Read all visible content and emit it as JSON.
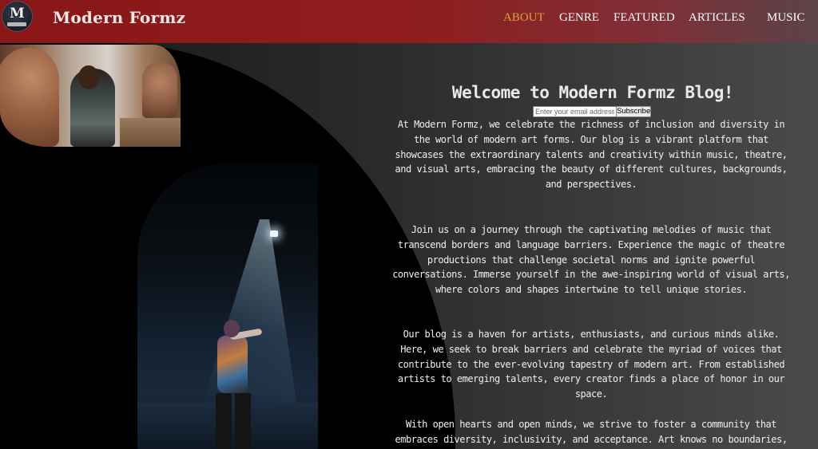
{
  "header": {
    "logo_letter": "M",
    "brand": "Modern Formz",
    "accent_color": "#d8a33a",
    "header_color": "#8a1717"
  },
  "nav": {
    "items": [
      {
        "label": "ABOUT",
        "active": true
      },
      {
        "label": "GENRE",
        "active": false
      },
      {
        "label": "FEATURED",
        "active": false
      },
      {
        "label": "ARTICLES",
        "active": false
      },
      {
        "label": "MUSIC",
        "active": false
      }
    ]
  },
  "main": {
    "title": "Welcome to Modern Formz Blog!",
    "subscribe": {
      "placeholder": "Enter your email address",
      "button_label": "Subscribe"
    },
    "paragraphs": [
      "At Modern Formz, we celebrate the richness of inclusion and diversity in the world of modern art forms. Our blog is a vibrant platform that showcases the extraordinary talents and creativity within music, theatre, and visual arts, embracing the beauty of different cultures, backgrounds, and perspectives.",
      "Join us on a journey through the captivating melodies of music that transcend borders and language barriers. Experience the magic of theatre productions that challenge societal norms and ignite powerful conversations. Immerse yourself in the awe-inspiring world of visual arts, where colors and shapes intertwine to tell unique stories.",
      "Our blog is a haven for artists, enthusiasts, and curious minds alike. Here, we seek to break barriers and celebrate the myriad of voices that contribute to the ever-evolving tapestry of modern art. From established artists to emerging talents, every creator finds a place of honor in our space.",
      "With open hearts and open minds, we strive to foster a community that embraces diversity, inclusivity, and acceptance. Art knows no boundaries,"
    ]
  },
  "images": {
    "top": "sculptor-workshop-photo",
    "stage": "dancer-on-stage-photo"
  }
}
